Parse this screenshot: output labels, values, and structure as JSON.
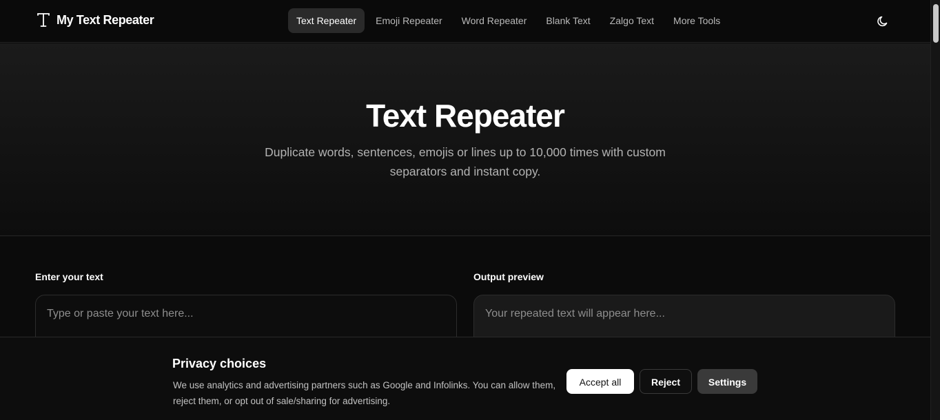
{
  "header": {
    "brand_name": "My Text Repeater",
    "nav": [
      {
        "label": "Text Repeater",
        "active": true
      },
      {
        "label": "Emoji Repeater",
        "active": false
      },
      {
        "label": "Word Repeater",
        "active": false
      },
      {
        "label": "Blank Text",
        "active": false
      },
      {
        "label": "Zalgo Text",
        "active": false
      },
      {
        "label": "More Tools",
        "active": false
      }
    ]
  },
  "hero": {
    "title": "Text Repeater",
    "subtitle": "Duplicate words, sentences, emojis or lines up to 10,000 times with custom separators and instant copy."
  },
  "input": {
    "label": "Enter your text",
    "placeholder": "Type or paste your text here..."
  },
  "output": {
    "label": "Output preview",
    "placeholder": "Your repeated text will appear here..."
  },
  "cookie": {
    "title": "Privacy choices",
    "text": "We use analytics and advertising partners such as Google and Infolinks. You can allow them, reject them, or opt out of sale/sharing for advertising.",
    "accept_label": "Accept all",
    "reject_label": "Reject",
    "settings_label": "Settings"
  },
  "icons": {
    "brand": "text-t-icon",
    "theme_toggle": "moon-icon"
  },
  "colors": {
    "background": "#0b0b0b",
    "accent_button": "#ffffff",
    "nav_active_bg": "#2a2a2a"
  }
}
